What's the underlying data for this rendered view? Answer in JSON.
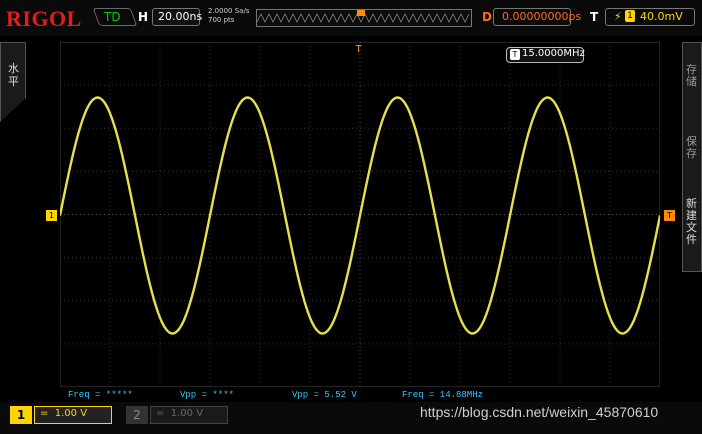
{
  "header": {
    "brand": "RIGOL",
    "trigger_status": "TD",
    "horizontal_label": "H",
    "timebase": "20.00ns",
    "sample_rate_line1": "2.0000 Sa/s",
    "sample_rate_line2": "700  pts",
    "delay_label": "D",
    "delay_value": "0.00000000ps",
    "trigger_label": "T",
    "trigger_channel": "1",
    "trigger_level": "40.0mV"
  },
  "side": {
    "left_tab": "水平",
    "right_items": [
      "存储",
      "保存",
      "新建文件"
    ]
  },
  "markers": {
    "ch1": "1",
    "trigger_right": "T",
    "trigger_top": "T"
  },
  "freq_badge": {
    "icon": "T",
    "value": "15.0000MHz"
  },
  "measurements": [
    "Freq = *****",
    "Vpp = ****",
    "Vpp = 5.52 V",
    "Freq = 14.88MHz"
  ],
  "channels": [
    {
      "number": "1",
      "scale": "1.00 V",
      "coupling": "="
    },
    {
      "number": "2",
      "scale": "1.00 V",
      "coupling": "="
    }
  ],
  "watermark": "https://blog.csdn.net/weixin_45870610",
  "colors": {
    "ch1": "#ffd400",
    "trigger": "#ff8c00",
    "measure": "#3ac7ff",
    "brand": "#e61b1b"
  }
}
